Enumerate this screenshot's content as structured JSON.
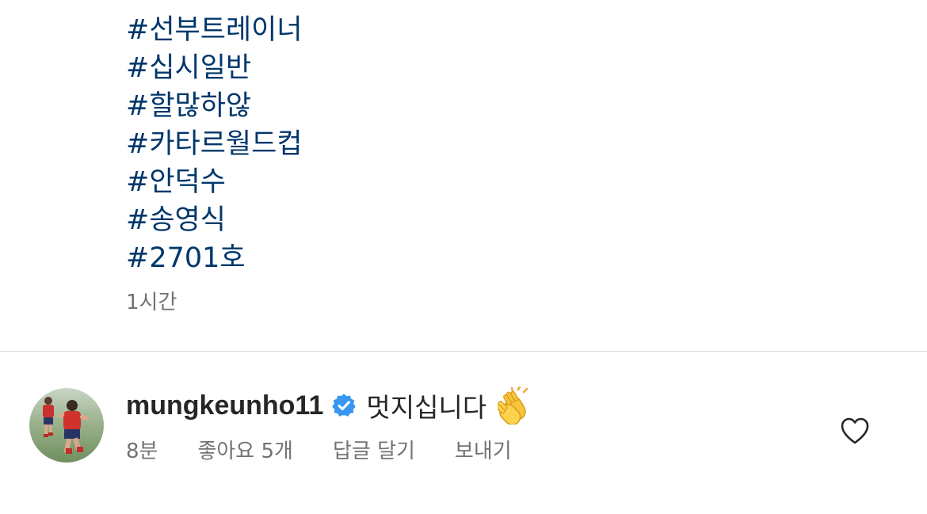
{
  "post": {
    "hashtags": [
      "#선부트레이너",
      "#십시일반",
      "#할많하않",
      "#카타르월드컵",
      "#안덕수",
      "#송영식",
      "#2701호"
    ],
    "timestamp": "1시간"
  },
  "comment": {
    "username": "mungkeunho11",
    "verified": true,
    "text": "멋지십니다",
    "emoji": "clapping-hands",
    "time": "8분",
    "likes": "좋아요 5개",
    "reply_label": "답글 달기",
    "send_label": "보내기"
  },
  "colors": {
    "hashtag": "#00376b",
    "secondary_text": "#737373",
    "primary_text": "#262626",
    "verified_badge": "#3897f0",
    "divider": "#dbdbdb"
  },
  "icons": {
    "verified": "verified-badge-icon",
    "like": "heart-outline-icon",
    "emoji": "clapping-hands-icon"
  }
}
